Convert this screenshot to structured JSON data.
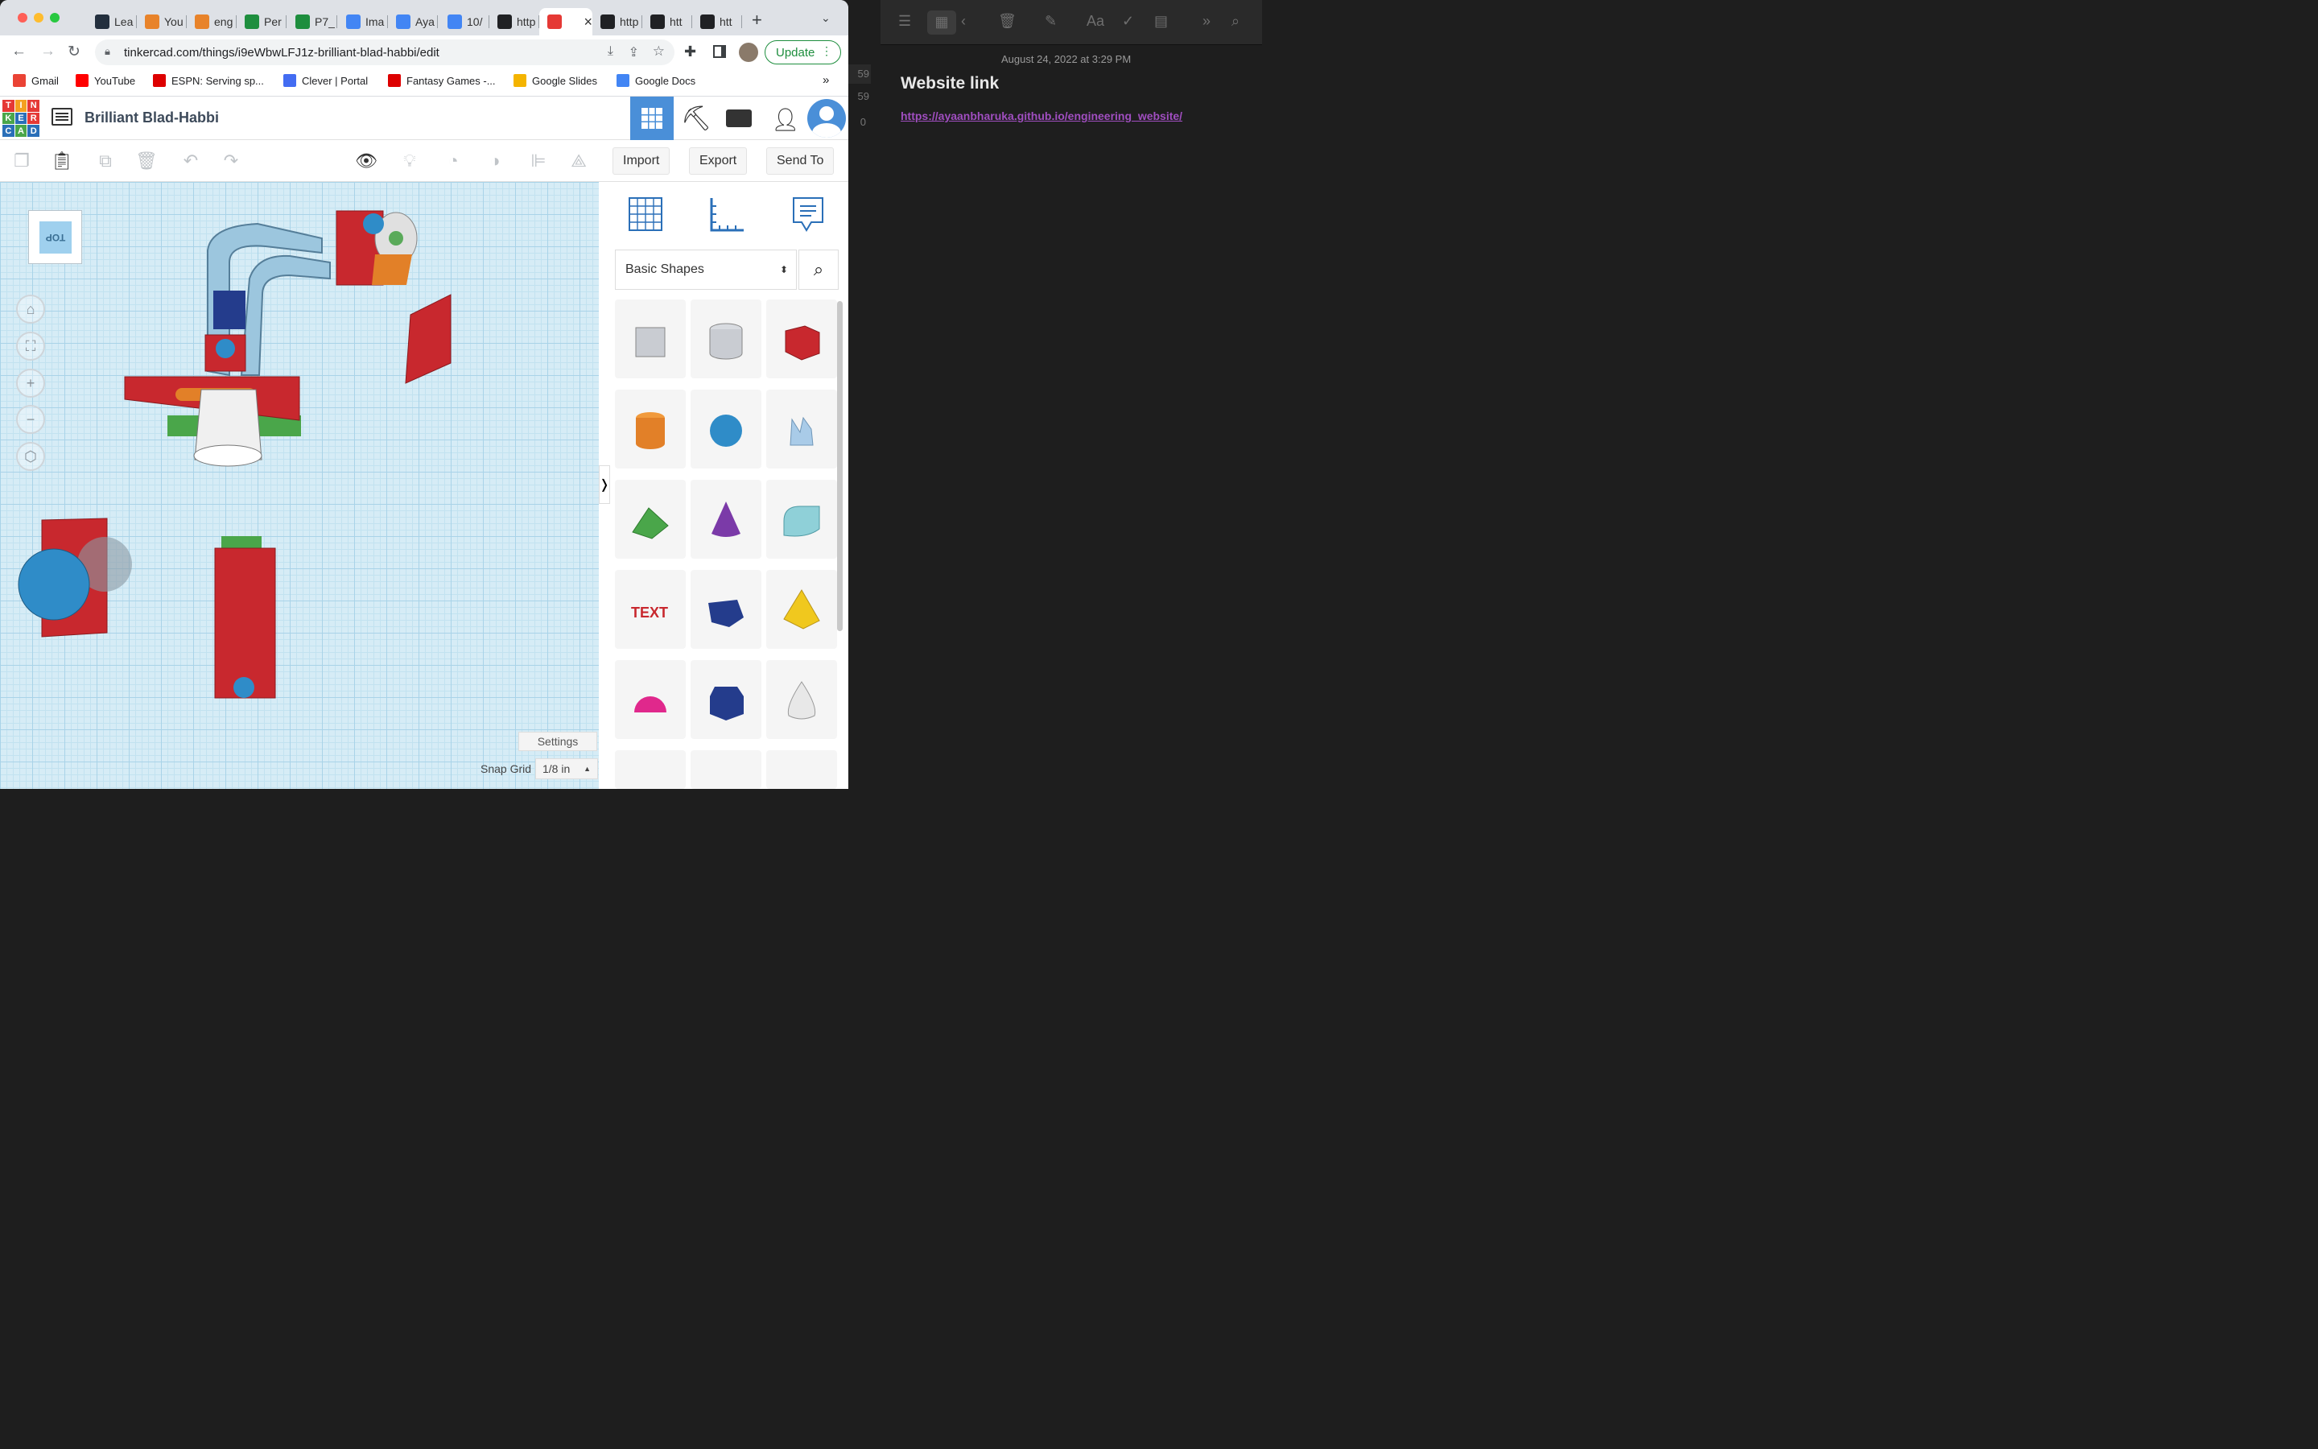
{
  "browser": {
    "tabs": [
      {
        "label": "Lea",
        "icon": "aws-icon",
        "color": "#232f3e"
      },
      {
        "label": "You",
        "icon": "box-icon",
        "color": "#e8832a"
      },
      {
        "label": "eng",
        "icon": "box-icon",
        "color": "#e8832a"
      },
      {
        "label": "Per",
        "icon": "sheets-icon",
        "color": "#1e8e3e"
      },
      {
        "label": "P7_",
        "icon": "classroom-icon",
        "color": "#1e8e3e"
      },
      {
        "label": "Ima",
        "icon": "drive-icon",
        "color": "#4285f4"
      },
      {
        "label": "Aya",
        "icon": "docs-icon",
        "color": "#4285f4"
      },
      {
        "label": "10/",
        "icon": "drive-icon",
        "color": "#4285f4"
      },
      {
        "label": "http",
        "icon": "globe-icon",
        "color": "#202124"
      },
      {
        "label": "",
        "icon": "tinkercad-icon",
        "color": "#e53935"
      },
      {
        "label": "http",
        "icon": "globe-icon",
        "color": "#202124"
      },
      {
        "label": "htt",
        "icon": "globe-icon",
        "color": "#202124"
      },
      {
        "label": "htt",
        "icon": "globe-icon",
        "color": "#202124"
      }
    ],
    "url": "tinkercad.com/things/i9eWbwLFJ1z-brilliant-blad-habbi/edit",
    "update_label": "Update",
    "bookmarks": [
      {
        "label": "Gmail",
        "color": "#ea4335"
      },
      {
        "label": "YouTube",
        "color": "#ff0000"
      },
      {
        "label": "ESPN: Serving sp...",
        "color": "#d00"
      },
      {
        "label": "Clever | Portal",
        "color": "#436cf2"
      },
      {
        "label": "Fantasy Games -...",
        "color": "#d00"
      },
      {
        "label": "Google Slides",
        "color": "#f4b400"
      },
      {
        "label": "Google Docs",
        "color": "#4285f4"
      }
    ],
    "more_bookmarks": "»"
  },
  "tinkercad": {
    "logo_letters": [
      "T",
      "I",
      "N",
      "K",
      "E",
      "R",
      "C",
      "A",
      "D"
    ],
    "title": "Brilliant Blad-Habbi",
    "import_label": "Import",
    "export_label": "Export",
    "send_label": "Send To",
    "view_cube": "TOP",
    "shape_category": "Basic Shapes",
    "settings_label": "Settings",
    "snap_label": "Snap Grid",
    "snap_value": "1/8 in",
    "collapse_glyph": "❭",
    "shapes": [
      "Box (hole)",
      "Cylinder (hole)",
      "Box",
      "Cylinder",
      "Sphere",
      "Scribble",
      "Roof",
      "Cone",
      "Round Roof",
      "Text",
      "Wedge",
      "Pyramid",
      "Half Sphere",
      "Polygon",
      "Paraboloid"
    ]
  },
  "notes": {
    "date": "August 24, 2022 at 3:29 PM",
    "heading": "Website link",
    "link": "https://ayaanbharuka.github.io/engineering_website/",
    "list_counts": [
      "59",
      "59",
      "0"
    ]
  }
}
